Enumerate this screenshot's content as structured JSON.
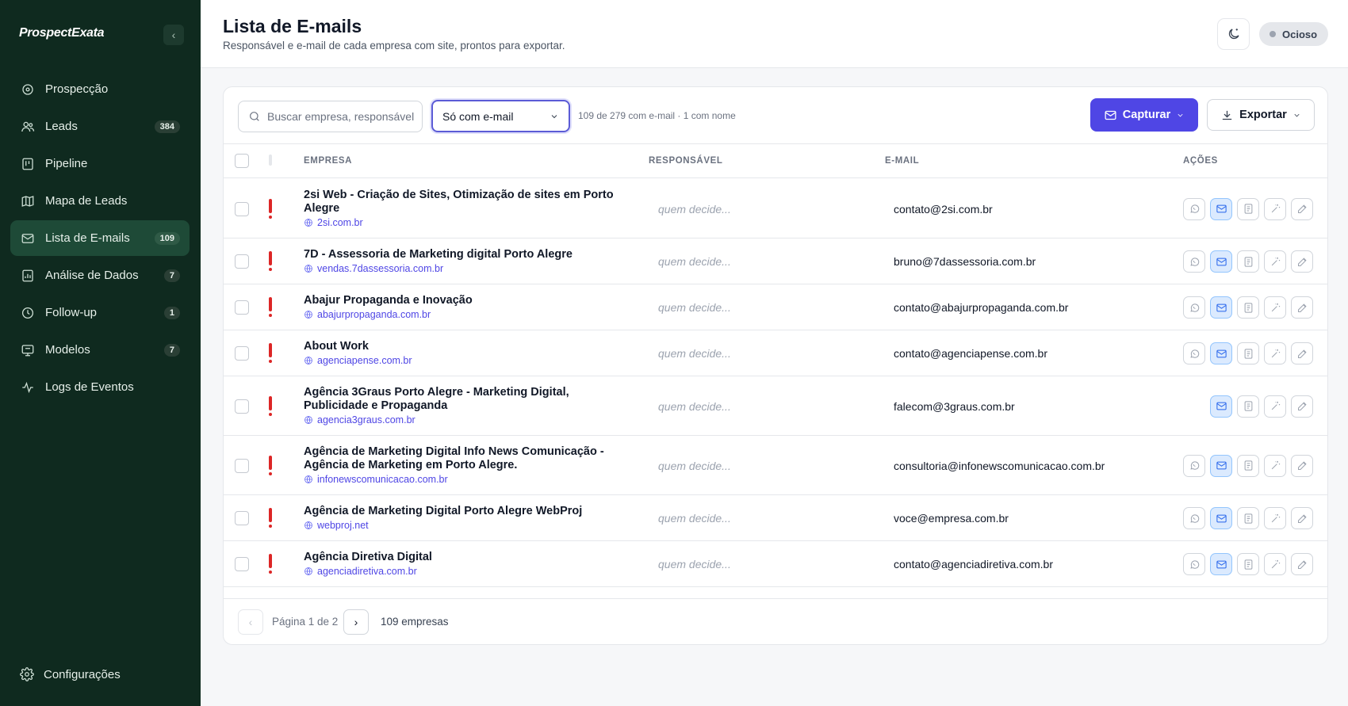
{
  "app": {
    "logo": "ProspectExata"
  },
  "sidebar": {
    "items": [
      {
        "label": "Prospecção",
        "icon": "target-icon",
        "badge": null,
        "active": false
      },
      {
        "label": "Leads",
        "icon": "users-icon",
        "badge": "384",
        "active": false
      },
      {
        "label": "Pipeline",
        "icon": "kanban-icon",
        "badge": null,
        "active": false
      },
      {
        "label": "Mapa de Leads",
        "icon": "map-icon",
        "badge": null,
        "active": false
      },
      {
        "label": "Lista de E-mails",
        "icon": "mail-list-icon",
        "badge": "109",
        "active": true
      },
      {
        "label": "Análise de Dados",
        "icon": "chart-icon",
        "badge": "7",
        "active": false
      },
      {
        "label": "Follow-up",
        "icon": "clock-icon",
        "badge": "1",
        "active": false
      },
      {
        "label": "Modelos",
        "icon": "template-icon",
        "badge": "7",
        "active": false
      },
      {
        "label": "Logs de Eventos",
        "icon": "activity-icon",
        "badge": null,
        "active": false
      }
    ],
    "settings_label": "Configurações"
  },
  "header": {
    "title": "Lista de E-mails",
    "subtitle": "Responsável e e-mail de cada empresa com site, prontos para exportar.",
    "status": "Ocioso"
  },
  "toolbar": {
    "search_placeholder": "Buscar empresa, responsável...",
    "filter_value": "Só com e-mail",
    "count_text": "109 de 279 com e-mail · 1 com nome",
    "capture_label": "Capturar",
    "export_label": "Exportar"
  },
  "table": {
    "headers": {
      "company": "EMPRESA",
      "responsible": "RESPONSÁVEL",
      "email": "E-MAIL",
      "actions": "AÇÕES"
    },
    "responsible_placeholder": "quem decide...",
    "rows": [
      {
        "name": "2si Web - Criação de Sites, Otimização de sites em Porto Alegre",
        "site": "2si.com.br",
        "email": "contato@2si.com.br",
        "whatsapp": true
      },
      {
        "name": "7D - Assessoria de Marketing digital Porto Alegre",
        "site": "vendas.7dassessoria.com.br",
        "email": "bruno@7dassessoria.com.br",
        "whatsapp": true
      },
      {
        "name": "Abajur Propaganda e Inovação",
        "site": "abajurpropaganda.com.br",
        "email": "contato@abajurpropaganda.com.br",
        "whatsapp": true
      },
      {
        "name": "About Work",
        "site": "agenciapense.com.br",
        "email": "contato@agenciapense.com.br",
        "whatsapp": true
      },
      {
        "name": "Agência 3Graus Porto Alegre - Marketing Digital, Publicidade e Propaganda",
        "site": "agencia3graus.com.br",
        "email": "falecom@3graus.com.br",
        "whatsapp": false
      },
      {
        "name": "Agência de Marketing Digital Info News Comunicação - Agência de Marketing em Porto Alegre.",
        "site": "infonewscomunicacao.com.br",
        "email": "consultoria@infonewscomunicacao.com.br",
        "whatsapp": true
      },
      {
        "name": "Agência de Marketing Digital Porto Alegre WebProj",
        "site": "webproj.net",
        "email": "voce@empresa.com.br",
        "whatsapp": true
      },
      {
        "name": "Agência Diretiva Digital",
        "site": "agenciadiretiva.com.br",
        "email": "contato@agenciadiretiva.com.br",
        "whatsapp": true
      }
    ]
  },
  "pagination": {
    "prev": "‹",
    "next": "›",
    "page_text": "Página 1 de 2",
    "total": "109 empresas"
  }
}
